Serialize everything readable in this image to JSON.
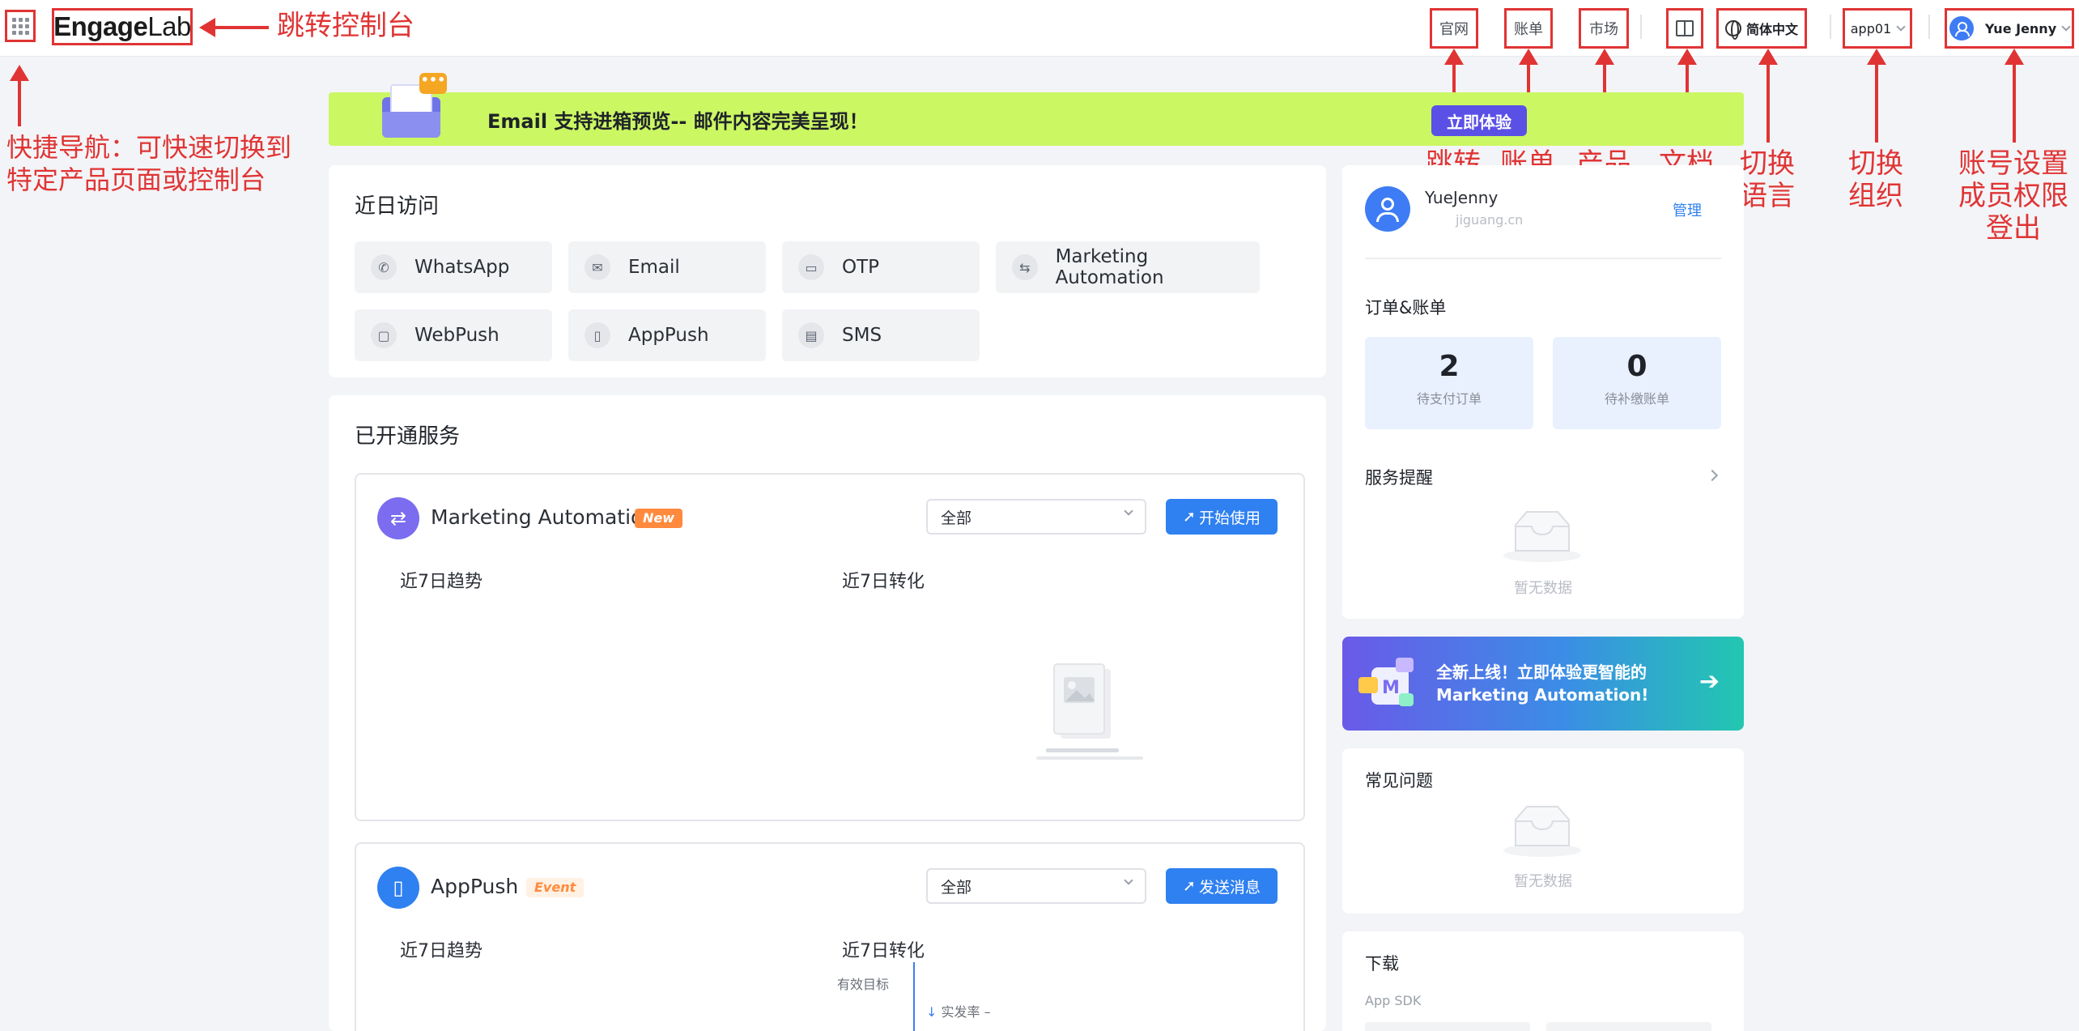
{
  "topbar": {
    "logo_main": "Engage",
    "logo_sub": "Lab",
    "nav": {
      "website": "官网",
      "billing": "账单",
      "market": "市场",
      "language": "简体中文",
      "org": "app01",
      "user": "Yue Jenny"
    }
  },
  "annotations": {
    "console": "跳转控制台",
    "quicknav": "快捷导航：可快速切换到\n特定产品页面或控制台",
    "website": "跳转\n官网",
    "billing": "账单\n管理",
    "market": "产品\n市场",
    "docs": "文档",
    "language": "切换\n语言",
    "org": "切换\n组织",
    "account": "账号设置\n成员权限\n登出"
  },
  "banner": {
    "bubble": "•••",
    "text": "Email 支持进箱预览-- 邮件内容完美呈现！",
    "button": "立即体验"
  },
  "recent": {
    "title": "近日访问",
    "items": [
      {
        "label": "WhatsApp",
        "icon": "whatsapp-icon"
      },
      {
        "label": "Email",
        "icon": "mail-icon"
      },
      {
        "label": "OTP",
        "icon": "otp-icon"
      },
      {
        "label": "Marketing Automation",
        "icon": "flow-icon"
      },
      {
        "label": "WebPush",
        "icon": "webpush-icon"
      },
      {
        "label": "AppPush",
        "icon": "apppush-icon"
      },
      {
        "label": "SMS",
        "icon": "sms-icon"
      }
    ]
  },
  "services": {
    "title": "已开通服务",
    "list": [
      {
        "name": "Marketing Automation",
        "tag": "New",
        "select": "全部",
        "button": "开始使用",
        "trend": "近7日趋势",
        "conversion": "近7日转化"
      },
      {
        "name": "AppPush",
        "tag": "Event",
        "select": "全部",
        "button": "发送消息",
        "trend": "近7日趋势",
        "conversion": "近7日转化",
        "goal_label": "有效目标",
        "rate_label": "实发率",
        "rate_value": "–"
      }
    ]
  },
  "profile": {
    "name": "YueJenny",
    "email": "jiguang.cn",
    "manage": "管理"
  },
  "orders": {
    "title": "订单&账单",
    "pending_pay": {
      "value": "2",
      "label": "待支付订单"
    },
    "pending_bill": {
      "value": "0",
      "label": "待补缴账单"
    }
  },
  "reminders": {
    "title": "服务提醒",
    "empty": "暂无数据"
  },
  "promo": {
    "line1": "全新上线！立即体验更智能的",
    "line2": "Marketing Automation!",
    "arrow": "➔"
  },
  "faq": {
    "title": "常见问题",
    "empty": "暂无数据"
  },
  "download": {
    "title": "下载",
    "sdk": "App SDK"
  },
  "colors": {
    "accent": "#2f80f0",
    "annotation": "#e03434",
    "banner": "#cbf763"
  }
}
